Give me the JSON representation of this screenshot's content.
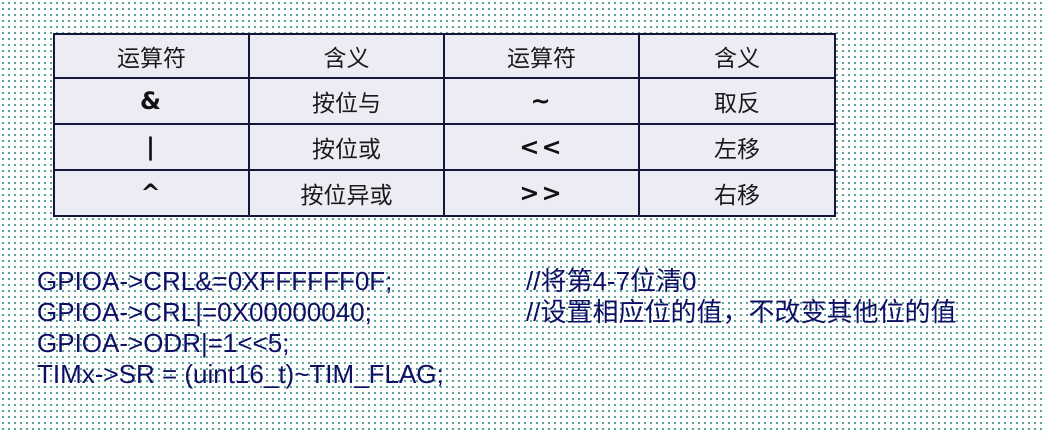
{
  "table": {
    "headers": [
      "运算符",
      "含义",
      "运算符",
      "含义"
    ],
    "rows": [
      {
        "op1": "&",
        "meaning1": "按位与",
        "op2": "~",
        "meaning2": "取反"
      },
      {
        "op1": "|",
        "meaning1": "按位或",
        "op2": "<<",
        "meaning2": "左移"
      },
      {
        "op1": "^",
        "meaning1": "按位异或",
        "op2": ">>",
        "meaning2": "右移"
      }
    ]
  },
  "code": [
    {
      "text": "GPIOA->CRL&=0XFFFFFF0F;",
      "comment": "//将第4-7位清0"
    },
    {
      "text": "GPIOA->CRL|=0X00000040;",
      "comment": "//设置相应位的值，不改变其他位的值"
    },
    {
      "text": "GPIOA->ODR|=1<<5;",
      "comment": ""
    },
    {
      "text": "TIMx->SR = (uint16_t)~TIM_FLAG;",
      "comment": ""
    }
  ],
  "colors": {
    "code_text": "#0f0f66",
    "table_bg": "#ececf4",
    "table_border": "#16163a",
    "dot_pattern": "#4f9a8e"
  }
}
